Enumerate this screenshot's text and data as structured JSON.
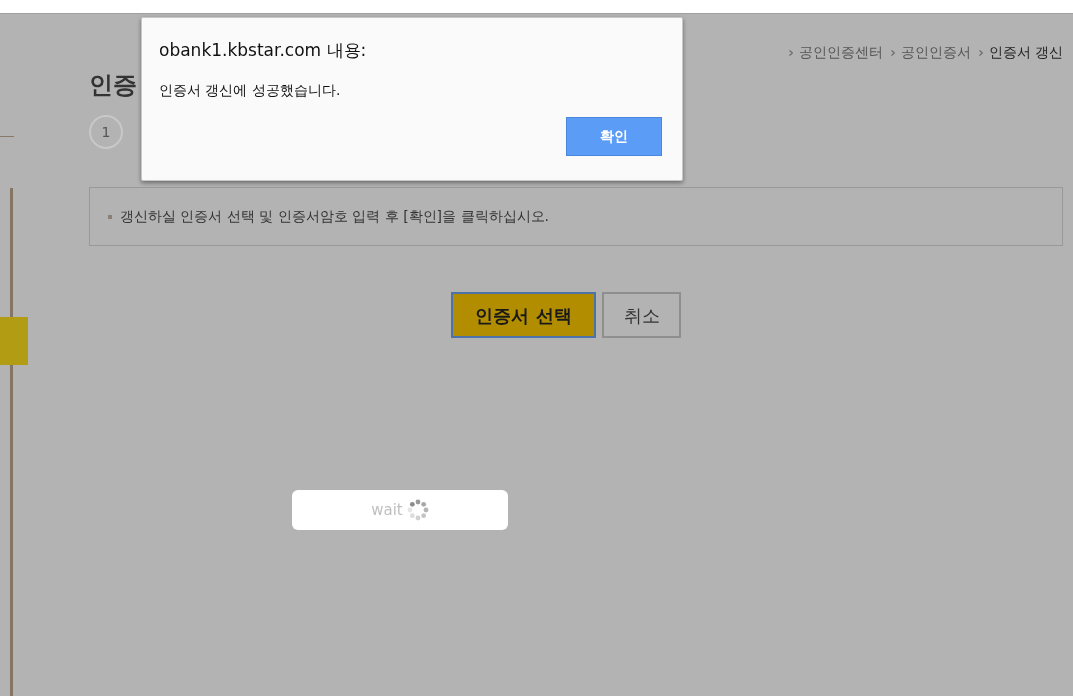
{
  "breadcrumb": [
    {
      "label": "공인인증센터",
      "current": false
    },
    {
      "label": "공인인증서",
      "current": false
    },
    {
      "label": "인증서 갱신",
      "current": true
    }
  ],
  "page_title": "인증",
  "steps": [
    {
      "label": "1"
    }
  ],
  "notice": "갱신하실 인증서 선택 및 인증서암호 입력 후 [확인]을 클릭하십시오.",
  "buttons": [
    {
      "label": "인증서 선택",
      "kind": "primary"
    },
    {
      "label": "취소",
      "kind": "secondary"
    }
  ],
  "loading": {
    "label": "wait"
  },
  "dialog": {
    "title": "obank1.kbstar.com 내용:",
    "message": "인증서 갱신에 성공했습니다.",
    "button": "확인"
  }
}
